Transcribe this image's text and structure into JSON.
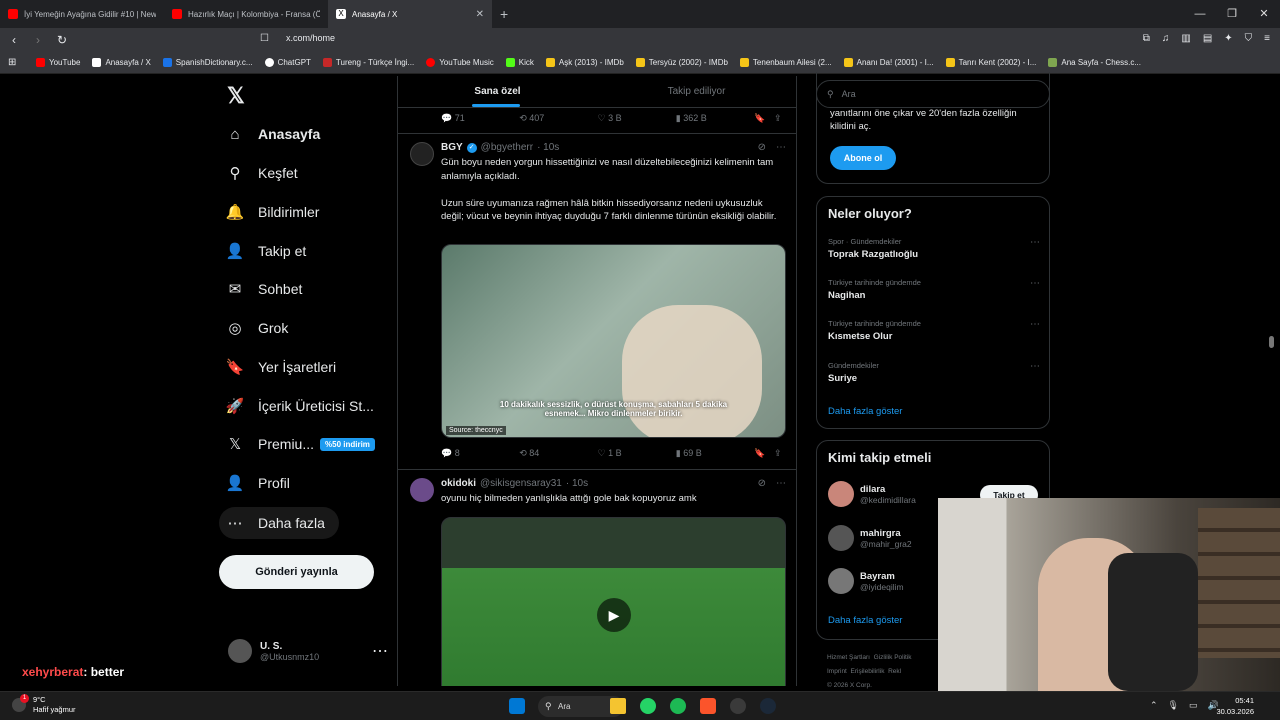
{
  "browser": {
    "tabs": [
      {
        "title": "İyi Yemeğin Ayağına Gidilir #10 | New",
        "favicon_color": "#ff0000"
      },
      {
        "title": "Hazırlık Maçı | Kolombiya - Fransa (Ö",
        "favicon_color": "#ff0000"
      },
      {
        "title": "Anasayfa / X",
        "favicon_color": "#ffffff"
      }
    ],
    "new_tab": "+",
    "url": "x.com/home",
    "bookmarks": [
      {
        "label": "YouTube",
        "color": "#ff0000"
      },
      {
        "label": "Anasayfa / X",
        "color": "#ffffff"
      },
      {
        "label": "SpanishDictionary.c...",
        "color": "#1a73e8"
      },
      {
        "label": "ChatGPT",
        "color": "#ffffff"
      },
      {
        "label": "Tureng - Türkçe İngi...",
        "color": "#c62828"
      },
      {
        "label": "YouTube Music",
        "color": "#ff0000"
      },
      {
        "label": "Kick",
        "color": "#53fc18"
      },
      {
        "label": "Aşk (2013) - IMDb",
        "color": "#f5c518"
      },
      {
        "label": "Tersyüz (2002) - IMDb",
        "color": "#f5c518"
      },
      {
        "label": "Tenenbaum Ailesi (2...",
        "color": "#f5c518"
      },
      {
        "label": "Ananı Da! (2001) - I...",
        "color": "#f5c518"
      },
      {
        "label": "Tanrı Kent (2002) - I...",
        "color": "#f5c518"
      },
      {
        "label": "Ana Sayfa - Chess.c...",
        "color": "#7fa650"
      }
    ]
  },
  "sidebar": {
    "logo": "𝕏",
    "items": [
      {
        "label": "Anasayfa",
        "icon": "⌂"
      },
      {
        "label": "Keşfet",
        "icon": "⚲"
      },
      {
        "label": "Bildirimler",
        "icon": "🔔"
      },
      {
        "label": "Takip et",
        "icon": "👤"
      },
      {
        "label": "Sohbet",
        "icon": "✉"
      },
      {
        "label": "Grok",
        "icon": "◎"
      },
      {
        "label": "Yer İşaretleri",
        "icon": "🔖"
      },
      {
        "label": "İçerik Üreticisi St...",
        "icon": "🚀"
      },
      {
        "label": "Premiu...",
        "icon": "𝕏"
      },
      {
        "label": "Profil",
        "icon": "👤"
      },
      {
        "label": "Daha fazla",
        "icon": "⋯"
      }
    ],
    "premium_badge": "%50 indirim",
    "post_button": "Gönderi yayınla",
    "account": {
      "name": "U. S.",
      "handle": "@Utkusnmz10"
    }
  },
  "feed": {
    "tabs": [
      "Sana özel",
      "Takip ediliyor"
    ],
    "top_actions": {
      "replies": "71",
      "reposts": "407",
      "likes": "3 B",
      "views": "362 B"
    },
    "tweets": [
      {
        "name": "BGY",
        "handle": "@bgyetherr",
        "time": "· 10s",
        "text": "Gün boyu neden yorgun hissettiğinizi ve nasıl düzeltebileceğinizi kelimenin tam anlamıyla açıkladı.\n\nUzun süre uyumanıza rağmen hâlâ bitkin hissediyorsanız nedeni uykusuzluk değil; vücut ve beynin ihtiyaç duyduğu 7 farklı dinlenme türünün eksikliği olabilir.",
        "caption": "10 dakikalık sessizlik, o dürüst konuşma, sabahları 5 dakika esnemek... Mikro dinlenmeler birikir.",
        "source": "Source: theccnyc",
        "actions": {
          "replies": "8",
          "reposts": "84",
          "likes": "1 B",
          "views": "69 B"
        }
      },
      {
        "name": "okidoki",
        "handle": "@sikisgensaray31",
        "time": "· 10s",
        "text": "oyunu hiç bilmeden yanlışlıkla attığı gole bak kopuyoruz amk"
      }
    ]
  },
  "right": {
    "search_placeholder": "Ara",
    "premium_text": "yanıtlarını öne çıkar ve 20'den fazla özelliğin kilidini aç.",
    "subscribe": "Abone ol",
    "trends_title": "Neler oluyor?",
    "trends": [
      {
        "context": "Spor · Gündemdekiler",
        "topic": "Toprak Razgatlıoğlu"
      },
      {
        "context": "Türkiye tarihinde gündemde",
        "topic": "Nagihan"
      },
      {
        "context": "Türkiye tarihinde gündemde",
        "topic": "Kısmetse Olur"
      },
      {
        "context": "Gündemdekiler",
        "topic": "Suriye"
      }
    ],
    "show_more": "Daha fazla göster",
    "who_title": "Kimi takip etmeli",
    "who": [
      {
        "name": "dilara",
        "handle": "@kedimidillara"
      },
      {
        "name": "mahirgra",
        "handle": "@mahir_gra2"
      },
      {
        "name": "Bayram",
        "handle": "@iyideqilim"
      }
    ],
    "follow": "Takip et",
    "show_more2": "Daha fazla göster",
    "footer": [
      "Hizmet Şartları",
      "Gizlilik Politik",
      "Imprint",
      "Erişilebilirlik",
      "Rekl",
      "© 2026 X Corp."
    ]
  },
  "overlay": {
    "chat_user": "xehyrberat",
    "chat_msg": ": better"
  },
  "taskbar": {
    "temp": "9°C",
    "weather": "Hafif yağmur",
    "search": "Ara",
    "time": "05:41",
    "date": "30.03.2026",
    "notif_count": "1"
  },
  "colors": {
    "accent": "#1d9bf0",
    "bg": "#000000"
  }
}
